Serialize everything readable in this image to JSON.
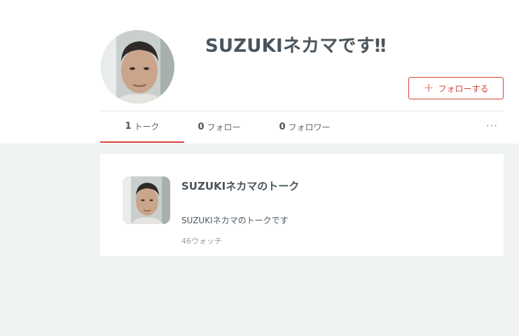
{
  "profile": {
    "name": "SUZUKIネカマです‼",
    "follow_label": "フォローする"
  },
  "tabs": [
    {
      "count": "1",
      "label": "トーク",
      "active": true
    },
    {
      "count": "0",
      "label": "フォロー",
      "active": false
    },
    {
      "count": "0",
      "label": "フォロワー",
      "active": false
    }
  ],
  "more_label": "···",
  "talks": [
    {
      "title": "SUZUKIネカマのトーク",
      "description": "SUZUKIネカマのトークです",
      "watch": "46ウォッチ"
    }
  ],
  "colors": {
    "accent": "#d8453a",
    "text": "#4a555d",
    "background": "#f0f3f3"
  },
  "icons": {
    "follow": "plus-icon",
    "more": "more-horizontal-icon",
    "avatar": "user-photo"
  }
}
